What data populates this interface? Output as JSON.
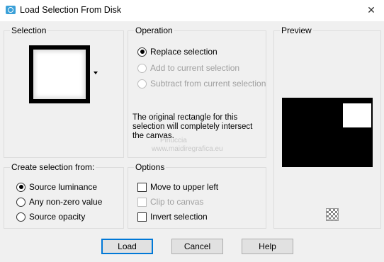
{
  "window": {
    "title": "Load Selection From Disk",
    "close_glyph": "✕"
  },
  "selection_group": {
    "label": "Selection",
    "dropdown_icon": "dropdown-arrow"
  },
  "operation_group": {
    "label": "Operation",
    "options": [
      {
        "label": "Replace selection",
        "checked": true,
        "enabled": true
      },
      {
        "label": "Add to current selection",
        "checked": false,
        "enabled": false
      },
      {
        "label": "Subtract from current selection",
        "checked": false,
        "enabled": false
      }
    ],
    "info_text": "The original rectangle for this selection will completely intersect the canvas."
  },
  "preview_group": {
    "label": "Preview",
    "toggle_icon": "checkerboard-icon"
  },
  "create_group": {
    "label": "Create selection from:",
    "options": [
      {
        "label": "Source luminance",
        "checked": true
      },
      {
        "label": "Any non-zero value",
        "checked": false
      },
      {
        "label": "Source opacity",
        "checked": false
      }
    ]
  },
  "options_group": {
    "label": "Options",
    "checkboxes": [
      {
        "label": "Move to upper left",
        "checked": false,
        "enabled": true
      },
      {
        "label": "Clip to canvas",
        "checked": false,
        "enabled": false
      },
      {
        "label": "Invert selection",
        "checked": false,
        "enabled": true
      }
    ]
  },
  "buttons": {
    "load": "Load",
    "cancel": "Cancel",
    "help": "Help"
  },
  "watermark": {
    "line1": "Pinuccia",
    "line2": "www.maidiregrafica.eu"
  },
  "colors": {
    "dialog_bg": "#f0f0f0",
    "default_button_border": "#0078d7",
    "disabled_text": "#a0a0a0"
  }
}
